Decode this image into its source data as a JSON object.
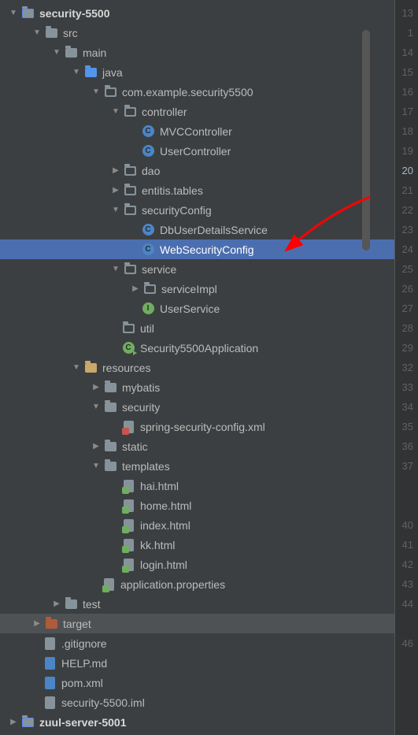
{
  "gutter": [
    "13",
    "1",
    "14",
    "15",
    "16",
    "17",
    "18",
    "19",
    "20",
    "21",
    "22",
    "23",
    "24",
    "25",
    "26",
    "27",
    "28",
    "29",
    "32",
    "33",
    "34",
    "35",
    "36",
    "37",
    "",
    "",
    "40",
    "41",
    "42",
    "43",
    "44",
    "",
    "46",
    "",
    "",
    "",
    ""
  ],
  "gutter_current_index": 8,
  "tree": {
    "root": "security-5500",
    "src": "src",
    "main": "main",
    "java": "java",
    "base_pkg": "com.example.security5500",
    "controller_pkg": "controller",
    "mvc_controller": "MVCController",
    "user_controller": "UserController",
    "dao_pkg": "dao",
    "entitis_pkg": "entitis.tables",
    "security_pkg": "securityConfig",
    "db_user_details": "DbUserDetailsService",
    "web_security_config": "WebSecurityConfig",
    "service_pkg": "service",
    "service_impl_pkg": "serviceImpl",
    "user_service": "UserService",
    "util_pkg": "util",
    "app_class": "Security5500Application",
    "resources": "resources",
    "mybatis": "mybatis",
    "security_res": "security",
    "spring_xml": "spring-security-config.xml",
    "static": "static",
    "templates": "templates",
    "hai_html": "hai.html",
    "home_html": "home.html",
    "index_html": "index.html",
    "kk_html": "kk.html",
    "login_html": "login.html",
    "app_props": "application.properties",
    "test": "test",
    "target": "target",
    "gitignore": ".gitignore",
    "help_md": "HELP.md",
    "pom": "pom.xml",
    "iml": "security-5500.iml",
    "zuul": "zuul-server-5001"
  }
}
